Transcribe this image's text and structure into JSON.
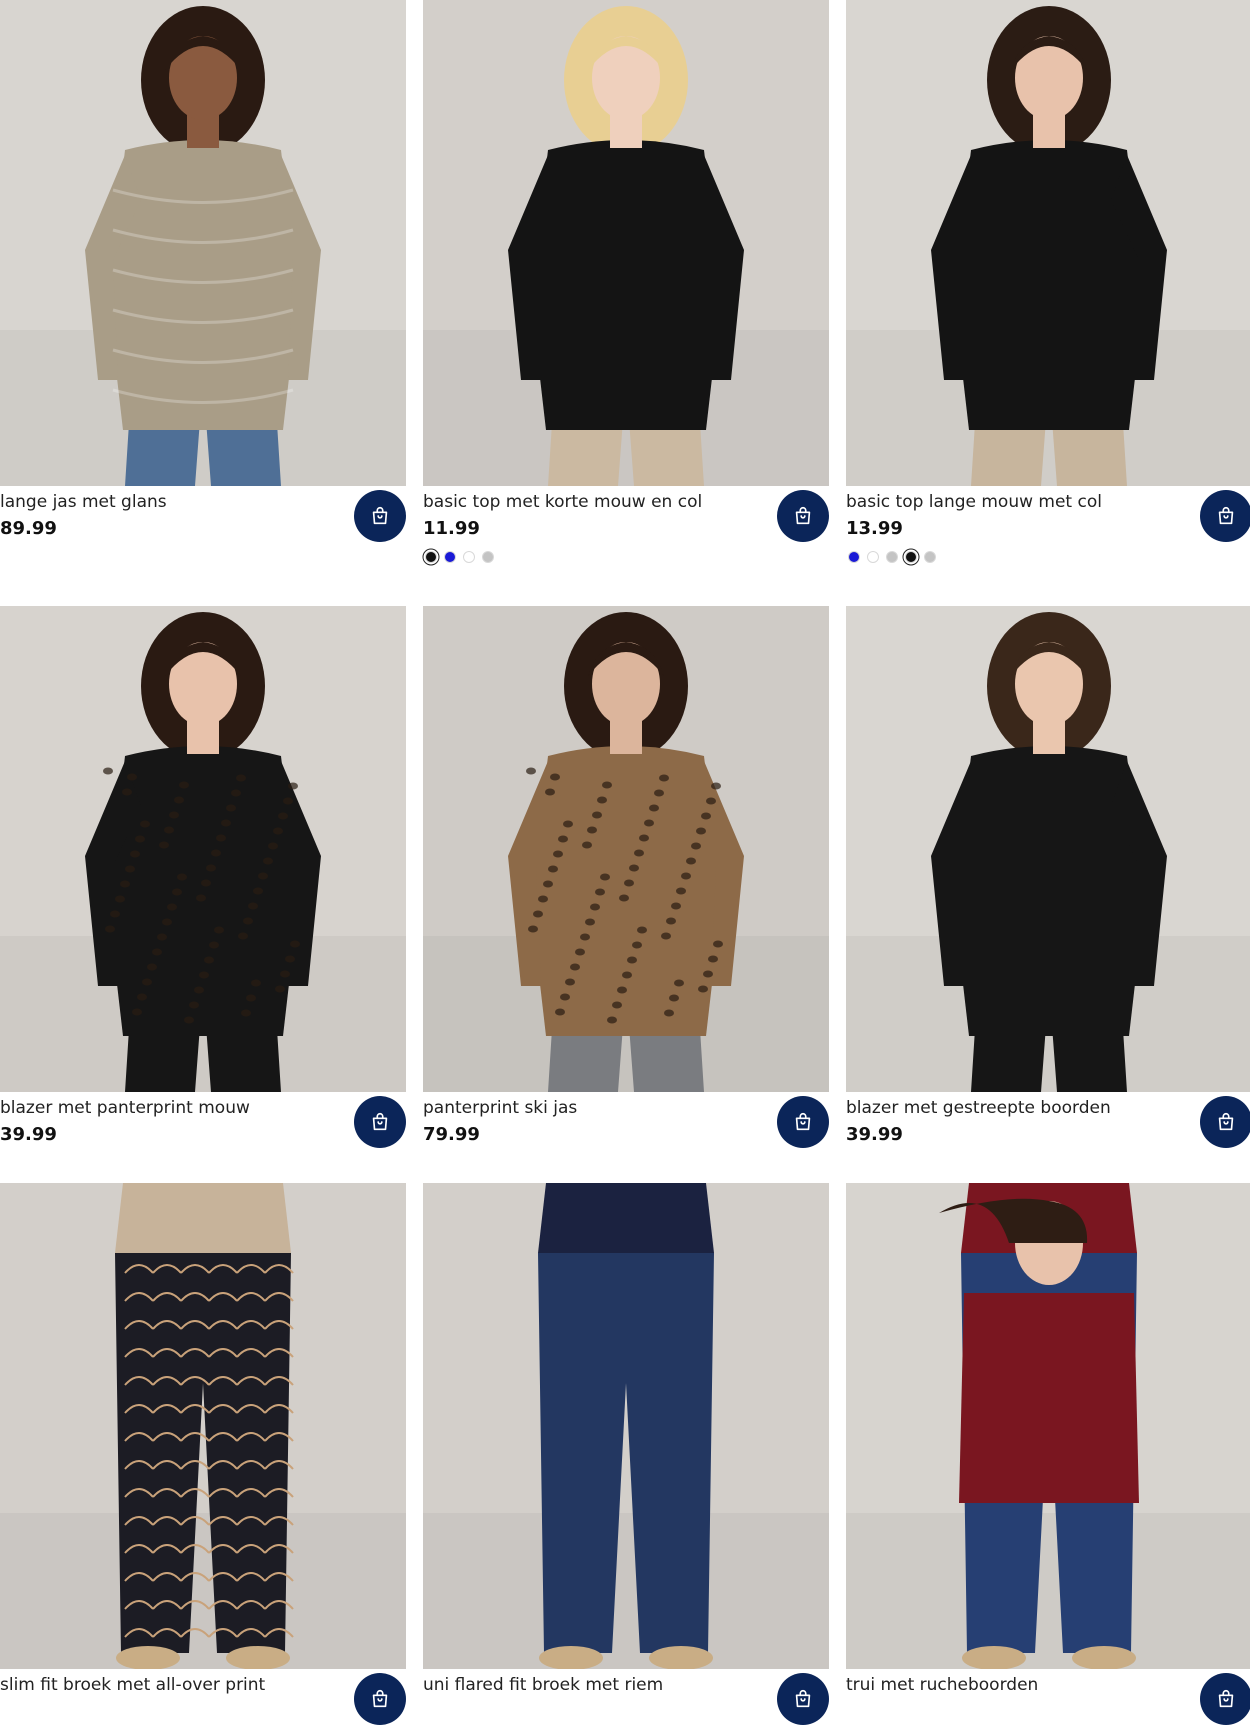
{
  "products": [
    {
      "title": "lange jas met glans",
      "price": "89.99",
      "bg": "#d8d5d0",
      "garment": "#a99d87",
      "lower": "#4f6f96",
      "skin": "#8a5a3f",
      "hair": "#2a1a12",
      "swatches": []
    },
    {
      "title": "basic top met korte mouw en col",
      "price": "11.99",
      "bg": "#d3cfca",
      "garment": "#141414",
      "lower": "#cbb9a1",
      "skin": "#efd0bd",
      "hair": "#e8cf93",
      "swatches": [
        {
          "color": "#111111",
          "selected": true
        },
        {
          "color": "#1a1ad6",
          "selected": false
        },
        {
          "color": "#ffffff",
          "selected": false
        },
        {
          "color": "#c4c4c4",
          "selected": false
        }
      ]
    },
    {
      "title": "basic top lange mouw met col",
      "price": "13.99",
      "bg": "#d9d6d1",
      "garment": "#141414",
      "lower": "#c7b59d",
      "skin": "#e8c2ab",
      "hair": "#2b1c14",
      "swatches": [
        {
          "color": "#1a1ad6",
          "selected": false
        },
        {
          "color": "#ffffff",
          "selected": false
        },
        {
          "color": "#c4c4c4",
          "selected": false
        },
        {
          "color": "#111111",
          "selected": true
        },
        {
          "color": "#c4c4c4",
          "selected": false
        }
      ]
    },
    {
      "title": "blazer met panterprint mouw",
      "price": "39.99",
      "bg": "#d7d3ce",
      "garment": "#161616",
      "lower": "#161616",
      "skin": "#e8c2ab",
      "hair": "#2a1a12",
      "swatches": []
    },
    {
      "title": "panterprint ski jas",
      "price": "79.99",
      "bg": "#cfcbc6",
      "garment": "#8d6a48",
      "lower": "#7a7c80",
      "skin": "#dcb59c",
      "hair": "#2a1a12",
      "swatches": []
    },
    {
      "title": "blazer met gestreepte boorden",
      "price": "39.99",
      "bg": "#d9d6d1",
      "garment": "#161616",
      "lower": "#161616",
      "skin": "#eac6ae",
      "hair": "#3a271a",
      "swatches": []
    },
    {
      "title": "slim fit broek met all-over print",
      "price": "",
      "bg": "#d3cfca",
      "garment": "#c7b39a",
      "lower": "#1c1c24",
      "skin": "#e8c2ab",
      "hair": "#2a1a12",
      "swatches": []
    },
    {
      "title": "uni flared fit broek met riem",
      "price": "",
      "bg": "#d3cfca",
      "garment": "#1b2240",
      "lower": "#233761",
      "skin": "#e8c2ab",
      "hair": "#2a1a12",
      "swatches": []
    },
    {
      "title": "trui met rucheboorden",
      "price": "",
      "bg": "#d7d4cf",
      "garment": "#7a1620",
      "lower": "#263f73",
      "skin": "#e8c2ab",
      "hair": "#2e1d14",
      "swatches": []
    }
  ]
}
